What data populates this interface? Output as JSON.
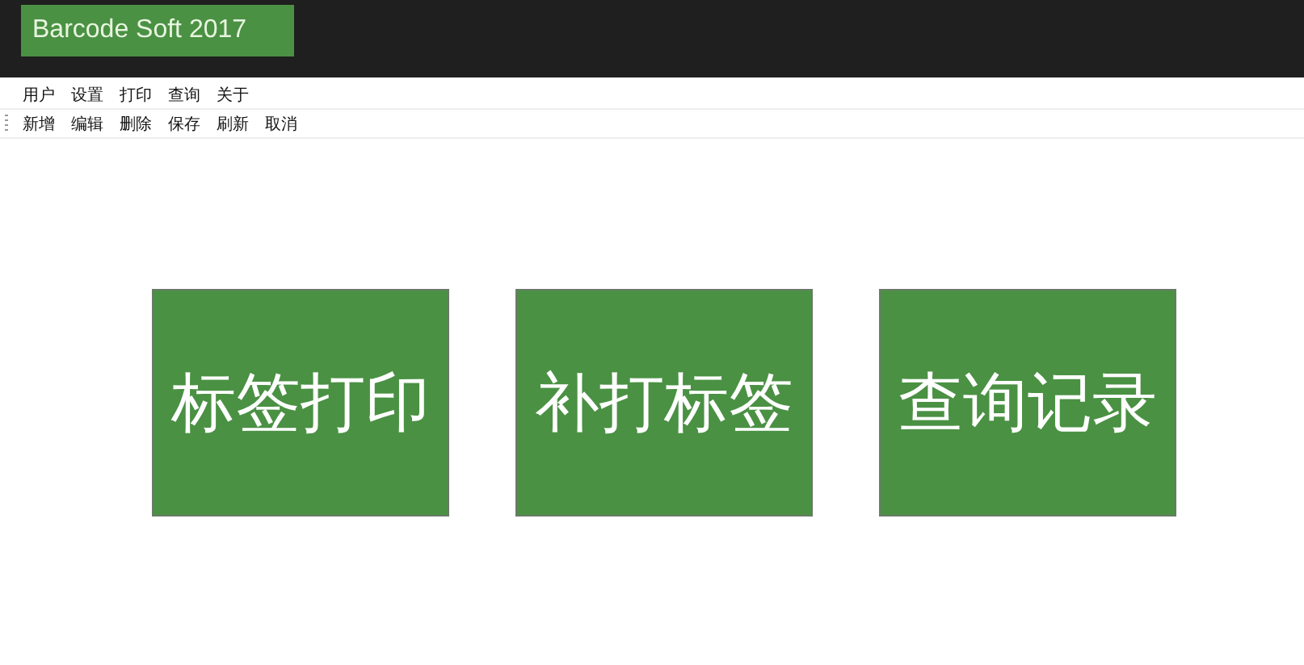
{
  "window": {
    "title": "Barcode Soft 2017"
  },
  "menu": [
    "用户",
    "设置",
    "打印",
    "查询",
    "关于"
  ],
  "toolbar": [
    "新增",
    "编辑",
    "删除",
    "保存",
    "刷新",
    "取消"
  ],
  "tiles": [
    "标签打印",
    "补打标签",
    "查询记录"
  ]
}
